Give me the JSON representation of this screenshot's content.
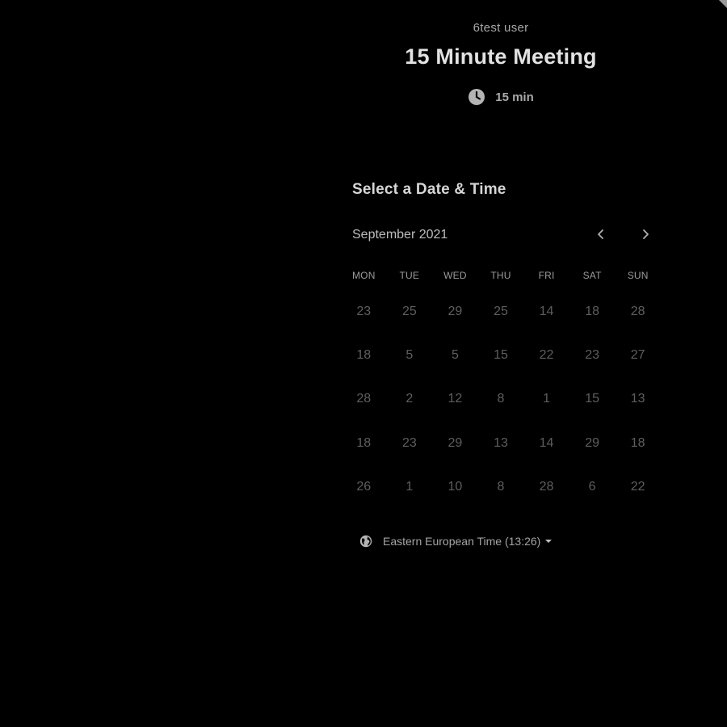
{
  "header": {
    "host_name": "6test user",
    "event_title": "15 Minute Meeting",
    "duration": "15 min",
    "icon": "clock-icon"
  },
  "scheduler": {
    "section_title": "Select a Date & Time",
    "month_label": "September 2021",
    "prev_icon": "chevron-left-icon",
    "next_icon": "chevron-right-icon",
    "weekdays": [
      "MON",
      "TUE",
      "WED",
      "THU",
      "FRI",
      "SAT",
      "SUN"
    ],
    "days": [
      "23",
      "25",
      "29",
      "25",
      "14",
      "18",
      "28",
      "18",
      "5",
      "5",
      "15",
      "22",
      "23",
      "27",
      "28",
      "2",
      "12",
      "8",
      "1",
      "15",
      "13",
      "18",
      "23",
      "29",
      "13",
      "14",
      "29",
      "18",
      "26",
      "1",
      "10",
      "8",
      "28",
      "6",
      "22"
    ]
  },
  "timezone": {
    "label": "Eastern European Time (13:26)",
    "icon": "globe-icon"
  },
  "colors": {
    "background": "#000000",
    "title": "#e2e2e2",
    "muted_text": "#a7a7a7",
    "disabled_day": "#5e5e5e"
  }
}
